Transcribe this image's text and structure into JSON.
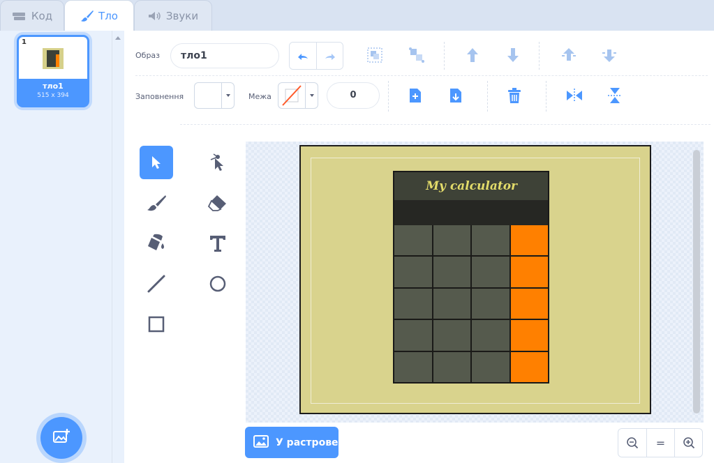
{
  "tabs": [
    {
      "label": "Код",
      "icon": "code-icon",
      "active": false
    },
    {
      "label": "Тло",
      "icon": "brush-icon",
      "active": true
    },
    {
      "label": "Звуки",
      "icon": "speaker-icon",
      "active": false
    }
  ],
  "costume_list": {
    "items": [
      {
        "index": "1",
        "name": "тло1",
        "size": "515 x 394",
        "selected": true
      }
    ],
    "add_button_icon": "add-backdrop-icon"
  },
  "toolbar": {
    "costume_label": "Образ",
    "costume_name": "тло1",
    "fill_label": "Заповнення",
    "fill_color": "#ffffff",
    "outline_label": "Межа",
    "outline_width": "0",
    "buttons": [
      "undo",
      "redo",
      "group",
      "ungroup",
      "forward",
      "backward",
      "front",
      "back",
      "copy",
      "paste",
      "delete",
      "flip-horizontal",
      "flip-vertical"
    ]
  },
  "tools": [
    "select",
    "reshape",
    "brush",
    "eraser",
    "fill",
    "text",
    "line",
    "circle",
    "rectangle"
  ],
  "canvas": {
    "background_color": "#d9d38d",
    "calculator_title": "My calculator",
    "key_color": "#555a4d",
    "operator_color": "#ff8000"
  },
  "footer": {
    "bitmap_button": "У растрове",
    "zoom_out": "−",
    "zoom_reset": "=",
    "zoom_in": "+"
  }
}
